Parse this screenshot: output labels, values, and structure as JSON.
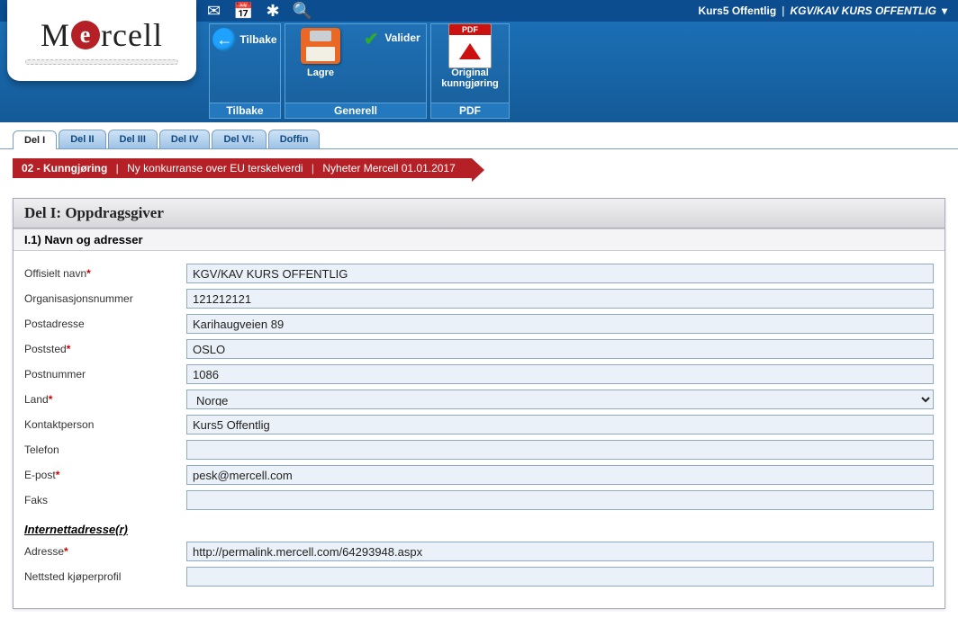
{
  "topbar": {
    "user": "Kurs5 Offentlig",
    "context": "KGV/KAV KURS OFFENTLIG"
  },
  "ribbon": {
    "groups": [
      {
        "label": "Tilbake",
        "buttons": [
          {
            "label": "Tilbake",
            "icon": "back"
          }
        ]
      },
      {
        "label": "Generell",
        "buttons": [
          {
            "label": "Lagre",
            "icon": "floppy"
          },
          {
            "label": "Valider",
            "icon": "check"
          }
        ]
      },
      {
        "label": "PDF",
        "buttons": [
          {
            "label": "Original kunngjøring",
            "icon": "pdf",
            "badge": "PDF"
          }
        ]
      }
    ]
  },
  "tabs": [
    "Del I",
    "Del II",
    "Del III",
    "Del IV",
    "Del VI:",
    "Doffin"
  ],
  "active_tab": 0,
  "banner": {
    "code": "02 - Kunngjøring",
    "mid": "Ny konkurranse over EU terskelverdi",
    "right": "Nyheter Mercell 01.01.2017"
  },
  "panel": {
    "title": "Del I: Oppdragsgiver",
    "section": "I.1) Navn og adresser",
    "internet_heading": "Internettadresse(r)",
    "fields": {
      "offisielt_navn": {
        "label": "Offisielt navn",
        "required": true,
        "value": "KGV/KAV KURS OFFENTLIG"
      },
      "orgnr": {
        "label": "Organisasjonsnummer",
        "required": false,
        "value": "121212121"
      },
      "postadresse": {
        "label": "Postadresse",
        "required": false,
        "value": "Karihaugveien 89"
      },
      "poststed": {
        "label": "Poststed",
        "required": true,
        "value": "OSLO"
      },
      "postnummer": {
        "label": "Postnummer",
        "required": false,
        "value": "1086"
      },
      "land": {
        "label": "Land",
        "required": true,
        "value": "Norge"
      },
      "kontaktperson": {
        "label": "Kontaktperson",
        "required": false,
        "value": "Kurs5 Offentlig"
      },
      "telefon": {
        "label": "Telefon",
        "required": false,
        "value": ""
      },
      "epost": {
        "label": "E-post",
        "required": true,
        "value": "pesk@mercell.com"
      },
      "faks": {
        "label": "Faks",
        "required": false,
        "value": ""
      },
      "adresse": {
        "label": "Adresse",
        "required": true,
        "value": "http://permalink.mercell.com/64293948.aspx"
      },
      "nettsted": {
        "label": "Nettsted kjøperprofil",
        "required": false,
        "value": ""
      }
    }
  },
  "logo": {
    "part1": "M",
    "badge": "e",
    "part2": "rcell"
  }
}
